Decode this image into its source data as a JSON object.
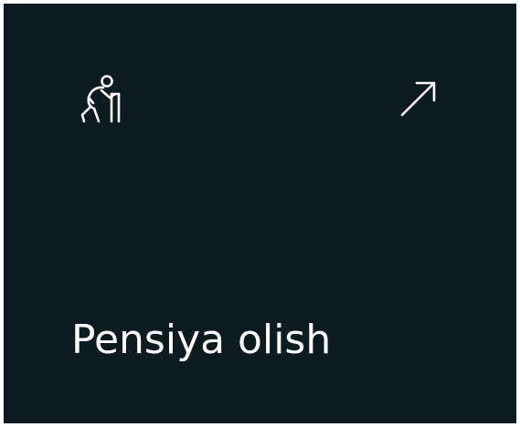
{
  "card": {
    "title": "Pensiya olish",
    "icon": "elderly-person-with-walker-icon",
    "action_icon": "arrow-up-right-icon",
    "background_color": "#0c1b20",
    "text_color": "#ffffff"
  }
}
